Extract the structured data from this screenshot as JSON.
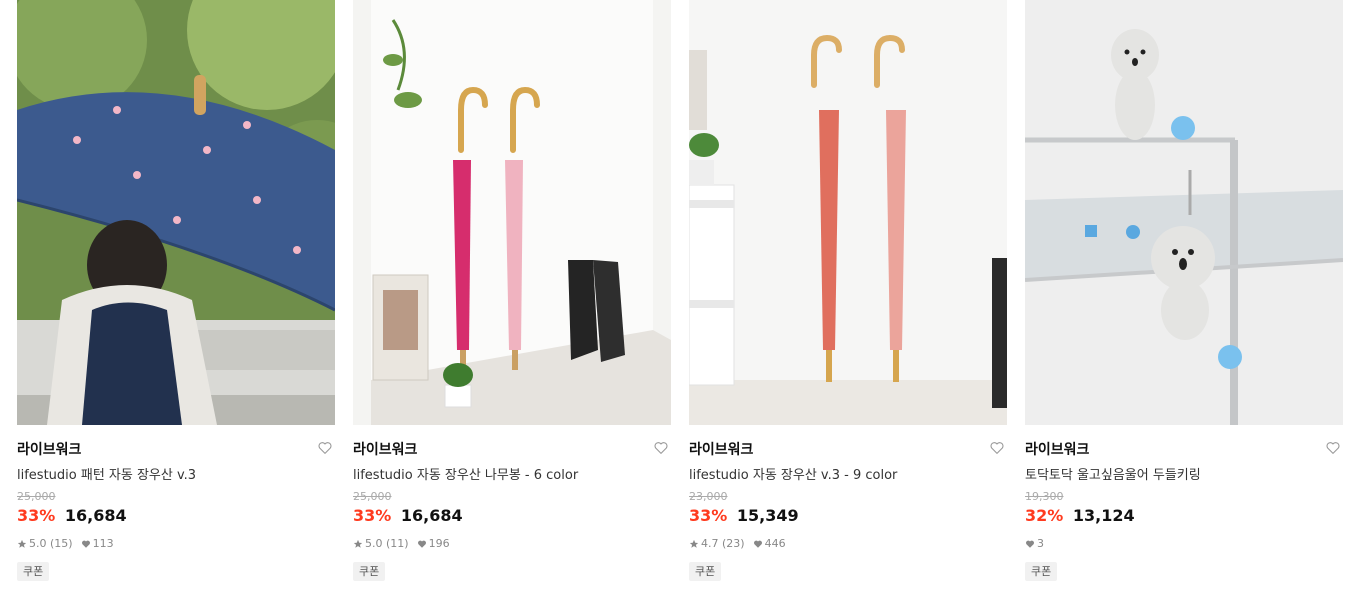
{
  "products": [
    {
      "brand": "라이브워크",
      "title": "lifestudio 패턴 자동 장우산 v.3",
      "original_price": "25,000",
      "discount": "33%",
      "price": "16,684",
      "rating": "5.0",
      "reviews": "(15)",
      "likes": "113",
      "coupon": "쿠폰"
    },
    {
      "brand": "라이브워크",
      "title": "lifestudio 자동 장우산 나무봉 - 6 color",
      "original_price": "25,000",
      "discount": "33%",
      "price": "16,684",
      "rating": "5.0",
      "reviews": "(11)",
      "likes": "196",
      "coupon": "쿠폰"
    },
    {
      "brand": "라이브워크",
      "title": "lifestudio 자동 장우산 v.3 - 9 color",
      "original_price": "23,000",
      "discount": "33%",
      "price": "15,349",
      "rating": "4.7",
      "reviews": "(23)",
      "likes": "446",
      "coupon": "쿠폰"
    },
    {
      "brand": "라이브워크",
      "title": "토닥토닥 울고싶음울어 두들키링",
      "original_price": "19,300",
      "discount": "32%",
      "price": "13,124",
      "likes": "3",
      "coupon": "쿠폰"
    }
  ],
  "colors": {
    "discount": "#ff3b1f",
    "icon_gray": "#888888"
  },
  "icons": {
    "wishlist": "heart-outline-icon",
    "rating": "star-icon",
    "likes": "heart-filled-icon"
  }
}
